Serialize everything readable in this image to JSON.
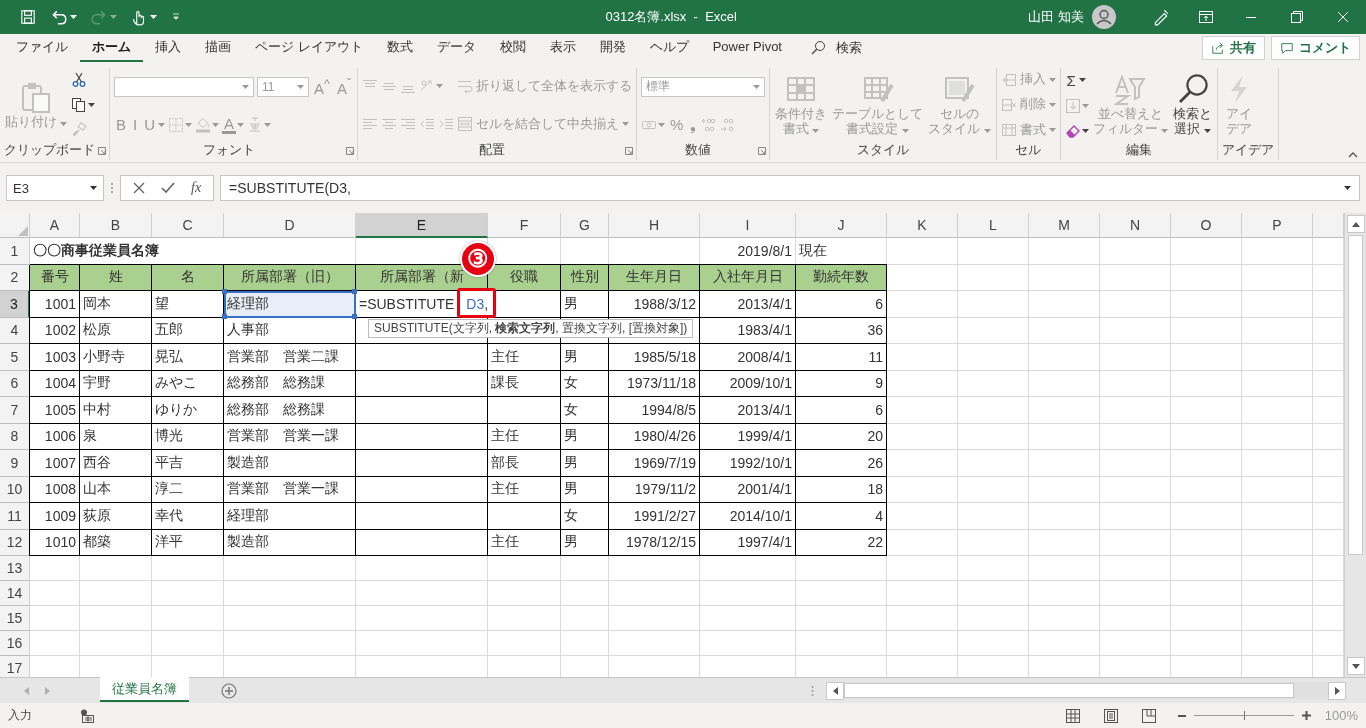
{
  "title_bar": {
    "quick_access": [
      {
        "kind": "save",
        "disabled": false
      },
      {
        "kind": "undo",
        "disabled": false
      },
      {
        "kind": "redo",
        "disabled": true
      },
      {
        "kind": "touch",
        "disabled": false
      },
      {
        "kind": "customize",
        "disabled": false
      }
    ],
    "title": "0312名簿.xlsx  -  Excel",
    "user": "山田 知美"
  },
  "menu_tabs": [
    {
      "label": "ファイル",
      "selected": false
    },
    {
      "label": "ホーム",
      "selected": true
    },
    {
      "label": "挿入",
      "selected": false
    },
    {
      "label": "描画",
      "selected": false
    },
    {
      "label": "ページ レイアウト",
      "selected": false
    },
    {
      "label": "数式",
      "selected": false
    },
    {
      "label": "データ",
      "selected": false
    },
    {
      "label": "校閲",
      "selected": false
    },
    {
      "label": "表示",
      "selected": false
    },
    {
      "label": "開発",
      "selected": false
    },
    {
      "label": "ヘルプ",
      "selected": false
    },
    {
      "label": "Power Pivot",
      "selected": false
    }
  ],
  "search": {
    "label": "検索"
  },
  "share_button": "共有",
  "comment_button": "コメント",
  "ribbon": {
    "groups": [
      {
        "label": "クリップボード",
        "launcher": true,
        "columns": [
          [
            [
              {
                "kind": "paste",
                "lines": [
                  "貼り付け"
                ],
                "disabled": true
              }
            ]
          ],
          [
            [
              {
                "kind": "cut",
                "disabled": false
              }
            ],
            [
              {
                "kind": "copy",
                "disabled": false
              }
            ],
            [
              {
                "kind": "painter",
                "disabled": true
              }
            ]
          ]
        ]
      },
      {
        "label": "フォント",
        "launcher": true,
        "columns": [
          [
            [
              {
                "kind": "fontfield",
                "disabled": true
              },
              {
                "kind": "sizefield",
                "value": "11",
                "disabled": true
              },
              {
                "kind": "glyph",
                "glyph": "A$^{^}$",
                "disabled": true
              },
              {
                "kind": "glyph",
                "glyph": "A$^{ˇ}$",
                "disabled": true
              }
            ],
            [
              {
                "kind": "glyph",
                "glyph": "B",
                "disabled": true
              },
              {
                "kind": "glyph",
                "glyph": "I",
                "disabled": true
              },
              {
                "kind": "underline",
                "glyph": "U",
                "disabled": true
              },
              {
                "kind": "border",
                "disabled": true
              },
              {
                "kind": "fill",
                "disabled": true
              },
              {
                "kind": "fontcolor",
                "glyph": "A",
                "disabled": true
              },
              {
                "kind": "phonetic",
                "disabled": true
              }
            ]
          ]
        ]
      },
      {
        "label": "配置",
        "launcher": true,
        "columns": [
          [
            [
              {
                "kind": "top",
                "disabled": true
              },
              {
                "kind": "middle",
                "disabled": true
              },
              {
                "kind": "bottom",
                "disabled": true
              },
              {
                "kind": "orient",
                "disabled": true
              }
            ],
            [
              {
                "kind": "left",
                "disabled": true
              },
              {
                "kind": "center",
                "disabled": true
              },
              {
                "kind": "right",
                "disabled": true
              },
              {
                "kind": "outdent",
                "disabled": true
              },
              {
                "kind": "indent",
                "disabled": true
              }
            ]
          ],
          [
            [
              {
                "kind": "wrap",
                "label": "折り返して全体を表示する",
                "disabled": true
              }
            ],
            [
              {
                "kind": "merge",
                "label": "セルを結合して中央揃え",
                "disabled": true
              }
            ]
          ]
        ]
      },
      {
        "label": "数値",
        "launcher": true,
        "columns": [
          [
            [
              {
                "kind": "formatfield",
                "value": "標準",
                "disabled": true
              }
            ],
            [
              {
                "kind": "accounting",
                "disabled": true
              },
              {
                "kind": "glyph",
                "glyph": "%",
                "disabled": true
              },
              {
                "kind": "glyph",
                "glyph": "❟",
                "disabled": true
              },
              {
                "kind": "incdec",
                "disabled": true
              },
              {
                "kind": "decdec",
                "disabled": true
              }
            ]
          ]
        ]
      },
      {
        "label": "スタイル",
        "launcher": false,
        "columns": [
          [
            [
              {
                "kind": "cond",
                "lines": [
                  "条件付き",
                  "書式"
                ],
                "disabled": true
              }
            ]
          ],
          [
            [
              {
                "kind": "table",
                "lines": [
                  "テーブルとして",
                  "書式設定"
                ],
                "disabled": true
              }
            ]
          ],
          [
            [
              {
                "kind": "styles",
                "lines": [
                  "セルの",
                  "スタイル"
                ],
                "disabled": true
              }
            ]
          ]
        ]
      },
      {
        "label": "セル",
        "launcher": false,
        "columns": [
          [
            [
              {
                "kind": "insert",
                "label": "挿入",
                "disabled": true
              }
            ],
            [
              {
                "kind": "delete",
                "label": "削除",
                "disabled": true
              }
            ],
            [
              {
                "kind": "format",
                "label": "書式",
                "disabled": true
              }
            ]
          ]
        ]
      },
      {
        "label": "編集",
        "launcher": false,
        "columns": [
          [
            [
              {
                "kind": "sum",
                "glyph": "Σ",
                "disabled": false
              }
            ],
            [
              {
                "kind": "filldown",
                "disabled": true
              }
            ],
            [
              {
                "kind": "eraser",
                "disabled": false
              }
            ]
          ],
          [
            [
              {
                "kind": "sort",
                "lines": [
                  "並べ替えと",
                  "フィルター"
                ],
                "disabled": true
              }
            ]
          ],
          [
            [
              {
                "kind": "find",
                "lines": [
                  "検索と",
                  "選択"
                ],
                "disabled": false
              }
            ]
          ]
        ]
      },
      {
        "label": "アイデア",
        "launcher": false,
        "columns": [
          [
            [
              {
                "kind": "ideas",
                "lines": [
                  "アイ",
                  "デア"
                ],
                "disabled": true
              }
            ]
          ]
        ]
      }
    ]
  },
  "formula_bar": {
    "name_box": "E3",
    "function_button": "fx",
    "formula": "=SUBSTITUTE(D3,"
  },
  "grid": {
    "columns": [
      {
        "label": "A",
        "selected": false
      },
      {
        "label": "B",
        "selected": false
      },
      {
        "label": "C",
        "selected": false
      },
      {
        "label": "D",
        "selected": false
      },
      {
        "label": "E",
        "selected": true
      },
      {
        "label": "F",
        "selected": false
      },
      {
        "label": "G",
        "selected": false
      },
      {
        "label": "H",
        "selected": false
      },
      {
        "label": "I",
        "selected": false
      },
      {
        "label": "J",
        "selected": false
      },
      {
        "label": "K",
        "selected": false
      },
      {
        "label": "L",
        "selected": false
      },
      {
        "label": "M",
        "selected": false
      },
      {
        "label": "N",
        "selected": false
      },
      {
        "label": "O",
        "selected": false
      },
      {
        "label": "P",
        "selected": false
      }
    ],
    "rows": [
      {
        "header": "1",
        "selected": false,
        "kind": "plain",
        "cells": [
          {
            "kind": "title",
            "text": "〇〇商事従業員名簿"
          },
          null,
          null,
          null,
          null,
          null,
          null,
          null,
          {
            "kind": "number",
            "text": "2019/8/1"
          },
          {
            "kind": "text",
            "text": "現在"
          }
        ]
      },
      {
        "header": "2",
        "selected": false,
        "kind": "table",
        "cells": [
          {
            "kind": "header",
            "text": "番号"
          },
          {
            "kind": "header",
            "text": "姓"
          },
          {
            "kind": "header",
            "text": "名"
          },
          {
            "kind": "header",
            "text": "所属部署（旧）"
          },
          {
            "kind": "header",
            "text": "所属部署（新"
          },
          {
            "kind": "header",
            "text": "役職"
          },
          {
            "kind": "header",
            "text": "性別"
          },
          {
            "kind": "header",
            "text": "生年月日"
          },
          {
            "kind": "header",
            "text": "入社年月日"
          },
          {
            "kind": "header",
            "text": "勤続年数"
          }
        ]
      },
      {
        "header": "3",
        "selected": true,
        "kind": "table",
        "cells": [
          {
            "kind": "number",
            "text": "1001"
          },
          {
            "kind": "text",
            "text": "岡本"
          },
          {
            "kind": "text",
            "text": "望"
          },
          {
            "kind": "reference",
            "text": "経理部"
          },
          {
            "kind": "editing",
            "before": "=SUBSTITUTE",
            "ref": "D3",
            "after": ","
          },
          null,
          {
            "kind": "text",
            "text": "男"
          },
          {
            "kind": "number",
            "text": "1988/3/12"
          },
          {
            "kind": "number",
            "text": "2013/4/1"
          },
          {
            "kind": "number",
            "text": "6"
          }
        ]
      },
      {
        "header": "4",
        "selected": false,
        "kind": "table",
        "cells": [
          {
            "kind": "number",
            "text": "1002"
          },
          {
            "kind": "text",
            "text": "松原"
          },
          {
            "kind": "text",
            "text": "五郎"
          },
          {
            "kind": "text",
            "text": "人事部"
          },
          null,
          null,
          null,
          null,
          {
            "kind": "number",
            "text": "1983/4/1"
          },
          {
            "kind": "number",
            "text": "36"
          }
        ]
      },
      {
        "header": "5",
        "selected": false,
        "kind": "table",
        "cells": [
          {
            "kind": "number",
            "text": "1003"
          },
          {
            "kind": "text",
            "text": "小野寺"
          },
          {
            "kind": "text",
            "text": "晃弘"
          },
          {
            "kind": "text",
            "text": "営業部　営業二課"
          },
          null,
          {
            "kind": "text",
            "text": "主任"
          },
          {
            "kind": "text",
            "text": "男"
          },
          {
            "kind": "number",
            "text": "1985/5/18"
          },
          {
            "kind": "number",
            "text": "2008/4/1"
          },
          {
            "kind": "number",
            "text": "11"
          }
        ]
      },
      {
        "header": "6",
        "selected": false,
        "kind": "table",
        "cells": [
          {
            "kind": "number",
            "text": "1004"
          },
          {
            "kind": "text",
            "text": "宇野"
          },
          {
            "kind": "text",
            "text": "みやこ"
          },
          {
            "kind": "text",
            "text": "総務部　総務課"
          },
          null,
          {
            "kind": "text",
            "text": "課長"
          },
          {
            "kind": "text",
            "text": "女"
          },
          {
            "kind": "number",
            "text": "1973/11/18"
          },
          {
            "kind": "number",
            "text": "2009/10/1"
          },
          {
            "kind": "number",
            "text": "9"
          }
        ]
      },
      {
        "header": "7",
        "selected": false,
        "kind": "table",
        "cells": [
          {
            "kind": "number",
            "text": "1005"
          },
          {
            "kind": "text",
            "text": "中村"
          },
          {
            "kind": "text",
            "text": "ゆりか"
          },
          {
            "kind": "text",
            "text": "総務部　総務課"
          },
          null,
          null,
          {
            "kind": "text",
            "text": "女"
          },
          {
            "kind": "number",
            "text": "1994/8/5"
          },
          {
            "kind": "number",
            "text": "2013/4/1"
          },
          {
            "kind": "number",
            "text": "6"
          }
        ]
      },
      {
        "header": "8",
        "selected": false,
        "kind": "table",
        "cells": [
          {
            "kind": "number",
            "text": "1006"
          },
          {
            "kind": "text",
            "text": "泉"
          },
          {
            "kind": "text",
            "text": "博光"
          },
          {
            "kind": "text",
            "text": "営業部　営業一課"
          },
          null,
          {
            "kind": "text",
            "text": "主任"
          },
          {
            "kind": "text",
            "text": "男"
          },
          {
            "kind": "number",
            "text": "1980/4/26"
          },
          {
            "kind": "number",
            "text": "1999/4/1"
          },
          {
            "kind": "number",
            "text": "20"
          }
        ]
      },
      {
        "header": "9",
        "selected": false,
        "kind": "table",
        "cells": [
          {
            "kind": "number",
            "text": "1007"
          },
          {
            "kind": "text",
            "text": "西谷"
          },
          {
            "kind": "text",
            "text": "平吉"
          },
          {
            "kind": "text",
            "text": "製造部"
          },
          null,
          {
            "kind": "text",
            "text": "部長"
          },
          {
            "kind": "text",
            "text": "男"
          },
          {
            "kind": "number",
            "text": "1969/7/19"
          },
          {
            "kind": "number",
            "text": "1992/10/1"
          },
          {
            "kind": "number",
            "text": "26"
          }
        ]
      },
      {
        "header": "10",
        "selected": false,
        "kind": "table",
        "cells": [
          {
            "kind": "number",
            "text": "1008"
          },
          {
            "kind": "text",
            "text": "山本"
          },
          {
            "kind": "text",
            "text": "淳二"
          },
          {
            "kind": "text",
            "text": "営業部　営業一課"
          },
          null,
          {
            "kind": "text",
            "text": "主任"
          },
          {
            "kind": "text",
            "text": "男"
          },
          {
            "kind": "number",
            "text": "1979/11/2"
          },
          {
            "kind": "number",
            "text": "2001/4/1"
          },
          {
            "kind": "number",
            "text": "18"
          }
        ]
      },
      {
        "header": "11",
        "selected": false,
        "kind": "table",
        "cells": [
          {
            "kind": "number",
            "text": "1009"
          },
          {
            "kind": "text",
            "text": "荻原"
          },
          {
            "kind": "text",
            "text": "幸代"
          },
          {
            "kind": "text",
            "text": "経理部"
          },
          null,
          null,
          {
            "kind": "text",
            "text": "女"
          },
          {
            "kind": "number",
            "text": "1991/2/27"
          },
          {
            "kind": "number",
            "text": "2014/10/1"
          },
          {
            "kind": "number",
            "text": "4"
          }
        ]
      },
      {
        "header": "12",
        "selected": false,
        "kind": "table",
        "cells": [
          {
            "kind": "number",
            "text": "1010"
          },
          {
            "kind": "text",
            "text": "都築"
          },
          {
            "kind": "text",
            "text": "洋平"
          },
          {
            "kind": "text",
            "text": "製造部"
          },
          null,
          {
            "kind": "text",
            "text": "主任"
          },
          {
            "kind": "text",
            "text": "男"
          },
          {
            "kind": "number",
            "text": "1978/12/15"
          },
          {
            "kind": "number",
            "text": "1997/4/1"
          },
          {
            "kind": "number",
            "text": "22"
          }
        ]
      },
      {
        "header": "13",
        "selected": false,
        "kind": "plain",
        "cells": []
      },
      {
        "header": "14",
        "selected": false,
        "kind": "plain",
        "cells": []
      },
      {
        "header": "15",
        "selected": false,
        "kind": "plain",
        "cells": []
      },
      {
        "header": "16",
        "selected": false,
        "kind": "plain",
        "cells": []
      },
      {
        "header": "17",
        "selected": false,
        "kind": "plain",
        "cells": []
      }
    ],
    "tooltip": "SUBSTITUTE(文字列, **検索文字列**, 置換文字列, [置換対象])",
    "callout": "③"
  },
  "sheet_tabs": [
    {
      "label": "従業員名簿",
      "selected": true
    }
  ],
  "status_bar": {
    "mode": "入力",
    "zoom": {
      "level": 0.5,
      "reading": "100%"
    }
  }
}
